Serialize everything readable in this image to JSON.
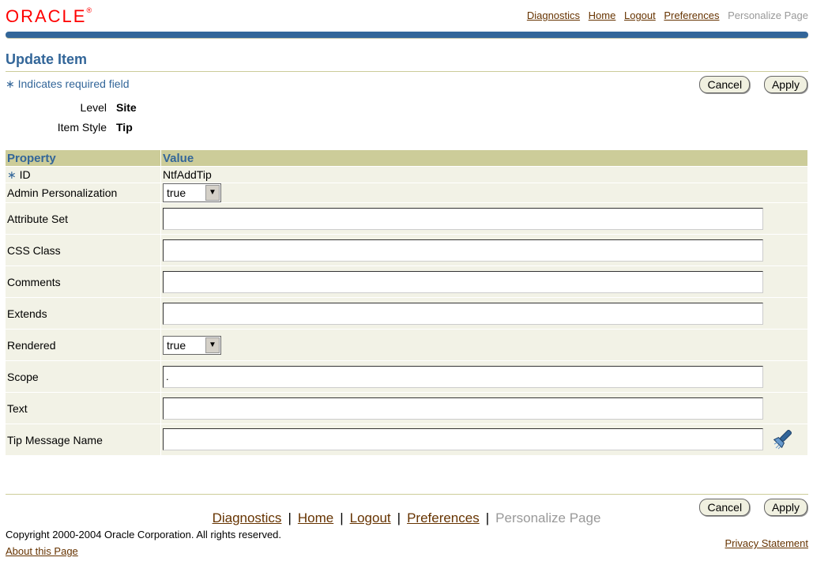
{
  "header": {
    "logo": "ORACLE",
    "logo_tm": "®",
    "global_links": [
      "Diagnostics",
      "Home",
      "Logout",
      "Preferences"
    ],
    "global_disabled": "Personalize Page"
  },
  "page": {
    "title": "Update Item",
    "required_note": "Indicates required field",
    "cancel": "Cancel",
    "apply": "Apply"
  },
  "meta": {
    "level_label": "Level",
    "level_value": "Site",
    "style_label": "Item Style",
    "style_value": "Tip"
  },
  "table": {
    "col_property": "Property",
    "col_value": "Value",
    "id_label": "ID",
    "id_value": "NtfAddTip",
    "admin_label": "Admin Personalization",
    "admin_value": "true",
    "attribute_set_label": "Attribute Set",
    "css_class_label": "CSS Class",
    "comments_label": "Comments",
    "extends_label": "Extends",
    "rendered_label": "Rendered",
    "rendered_value": "true",
    "scope_label": "Scope",
    "scope_value": ".",
    "text_label": "Text",
    "tip_label": "Tip Message Name"
  },
  "footer": {
    "links": [
      "Diagnostics",
      "Home",
      "Logout",
      "Preferences"
    ],
    "disabled": "Personalize Page",
    "copyright": "Copyright 2000-2004 Oracle Corporation. All rights reserved.",
    "about": "About this Page",
    "privacy": "Privacy Statement"
  },
  "colors": {
    "accent": "#336699",
    "table_header": "#cccc99",
    "logo": "#ff0000",
    "link": "#663300"
  }
}
